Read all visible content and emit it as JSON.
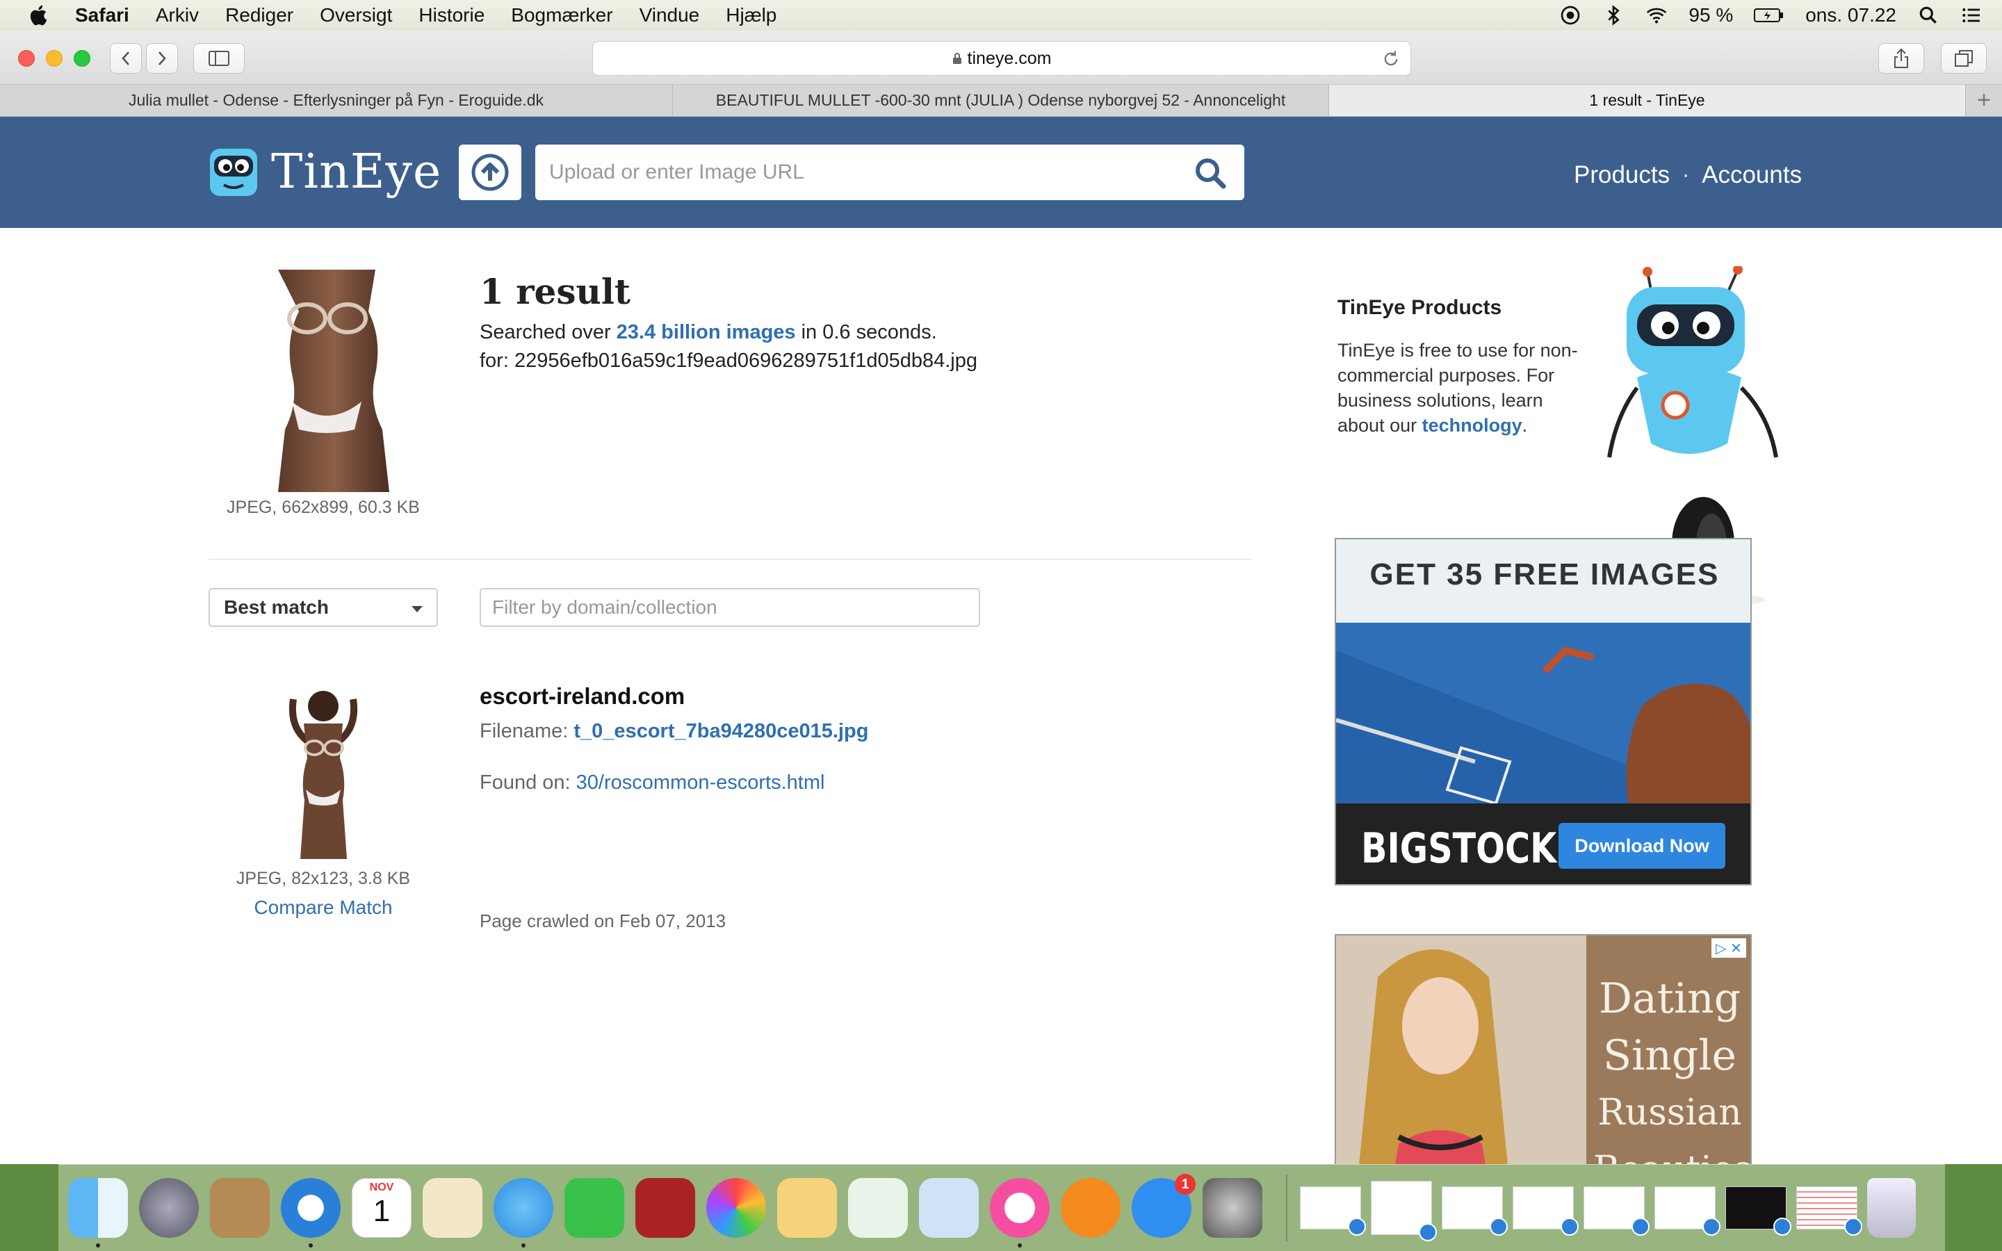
{
  "menubar": {
    "items": [
      "Safari",
      "Arkiv",
      "Rediger",
      "Oversigt",
      "Historie",
      "Bogmærker",
      "Vindue",
      "Hjælp"
    ],
    "battery": "95 %",
    "clock": "ons. 07.22"
  },
  "browser": {
    "url": "tineye.com",
    "tabs": [
      {
        "label": "Julia mullet - Odense - Efterlysninger på Fyn - Eroguide.dk"
      },
      {
        "label": "BEAUTIFUL MULLET -600-30 mnt (JULIA ) Odense nyborgvej 52 - Annoncelight"
      },
      {
        "label": "1 result - TinEye"
      }
    ]
  },
  "header": {
    "logo_text": "TinEye",
    "search_placeholder": "Upload or enter Image URL",
    "nav": {
      "products": "Products",
      "separator": "·",
      "accounts": "Accounts"
    }
  },
  "query": {
    "caption": "JPEG, 662x899, 60.3 KB",
    "result_count": "1 result",
    "searched_prefix": "Searched over ",
    "searched_link": "23.4 billion images",
    "searched_suffix": " in 0.6 seconds.",
    "for_line": "for: 22956efb016a59c1f9ead0696289751f1d05db84.jpg"
  },
  "controls": {
    "sort_value": "Best match",
    "filter_placeholder": "Filter by domain/collection"
  },
  "match": {
    "domain": "escort-ireland.com",
    "filename_label": "Filename: ",
    "filename": "t_0_escort_7ba94280ce015.jpg",
    "found_label": "Found on: ",
    "found_link": "30/roscommon-escorts.html",
    "crawled": "Page crawled on Feb 07, 2013",
    "caption": "JPEG, 82x123, 3.8 KB",
    "compare": "Compare Match"
  },
  "sidebar": {
    "title": "TinEye Products",
    "text_1": "TinEye is free to use for non-commercial purposes. For business solutions, learn about our ",
    "text_link": "technology",
    "text_2": "."
  },
  "ads": {
    "ad1_headline": "GET 35 FREE IMAGES",
    "ad1_brand": "BIGSTOCK",
    "ad1_button": "Download Now",
    "ad2_line1": "Dating",
    "ad2_line2": "Single",
    "ad2_line3": "Russian",
    "ad2_line4": "Beauties"
  },
  "dock": {
    "calendar_month": "NOV",
    "calendar_day": "1",
    "appstore_badge": "1"
  },
  "colors": {
    "header_bg": "#3c5f8d",
    "link": "#2f6fb1"
  }
}
